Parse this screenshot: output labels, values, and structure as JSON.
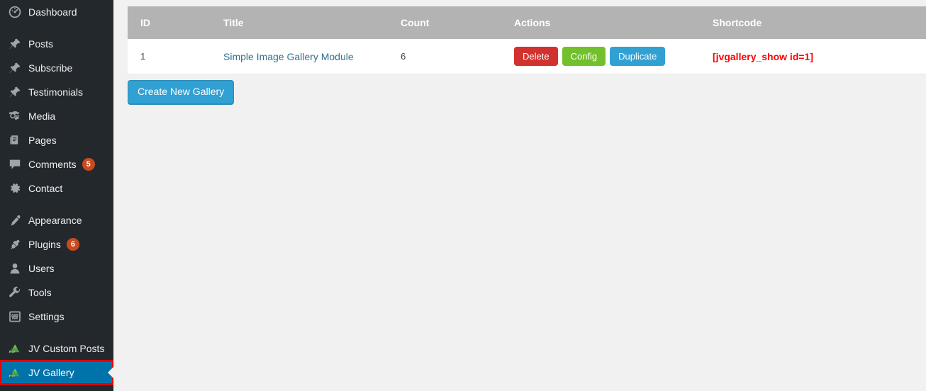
{
  "sidebar": {
    "items": [
      {
        "label": "Dashboard",
        "icon": "dashboard-icon",
        "badge": null,
        "current": false,
        "group": 0
      },
      {
        "label": "Posts",
        "icon": "pin-icon",
        "badge": null,
        "current": false,
        "group": 1
      },
      {
        "label": "Subscribe",
        "icon": "pin-icon",
        "badge": null,
        "current": false,
        "group": 1
      },
      {
        "label": "Testimonials",
        "icon": "pin-icon",
        "badge": null,
        "current": false,
        "group": 1
      },
      {
        "label": "Media",
        "icon": "media-icon",
        "badge": null,
        "current": false,
        "group": 1
      },
      {
        "label": "Pages",
        "icon": "pages-icon",
        "badge": null,
        "current": false,
        "group": 1
      },
      {
        "label": "Comments",
        "icon": "comment-icon",
        "badge": "5",
        "current": false,
        "group": 1
      },
      {
        "label": "Contact",
        "icon": "gear-icon",
        "badge": null,
        "current": false,
        "group": 1
      },
      {
        "label": "Appearance",
        "icon": "brush-icon",
        "badge": null,
        "current": false,
        "group": 2
      },
      {
        "label": "Plugins",
        "icon": "plug-icon",
        "badge": "6",
        "current": false,
        "group": 2
      },
      {
        "label": "Users",
        "icon": "user-icon",
        "badge": null,
        "current": false,
        "group": 2
      },
      {
        "label": "Tools",
        "icon": "wrench-icon",
        "badge": null,
        "current": false,
        "group": 2
      },
      {
        "label": "Settings",
        "icon": "settings-icon",
        "badge": null,
        "current": false,
        "group": 2
      },
      {
        "label": "JV Custom Posts",
        "icon": "jv-mountain-icon",
        "badge": null,
        "current": false,
        "group": 3
      },
      {
        "label": "JV Gallery",
        "icon": "jv-mountain-icon",
        "badge": null,
        "current": true,
        "group": 3
      }
    ],
    "badge_color": "#ca4a1f",
    "current_color": "#0073aa",
    "annotation_color": "#e60000"
  },
  "main": {
    "table": {
      "columns": [
        "ID",
        "Title",
        "Count",
        "Actions",
        "Shortcode"
      ],
      "rows": [
        {
          "id": "1",
          "title": "Simple Image Gallery Module",
          "count": "6",
          "actions": [
            {
              "label": "Delete",
              "style": "btn-delete",
              "color": "#d2322d"
            },
            {
              "label": "Config",
              "style": "btn-config",
              "color": "#72c02c"
            },
            {
              "label": "Duplicate",
              "style": "btn-duplicate",
              "color": "#31a0d3"
            }
          ],
          "shortcode": "[jvgallery_show id=1]"
        }
      ]
    },
    "create_button_label": "Create New Gallery",
    "header_bg": "#b3b3b3",
    "shortcode_color": "#ff0000",
    "title_link_color": "#31708f"
  }
}
